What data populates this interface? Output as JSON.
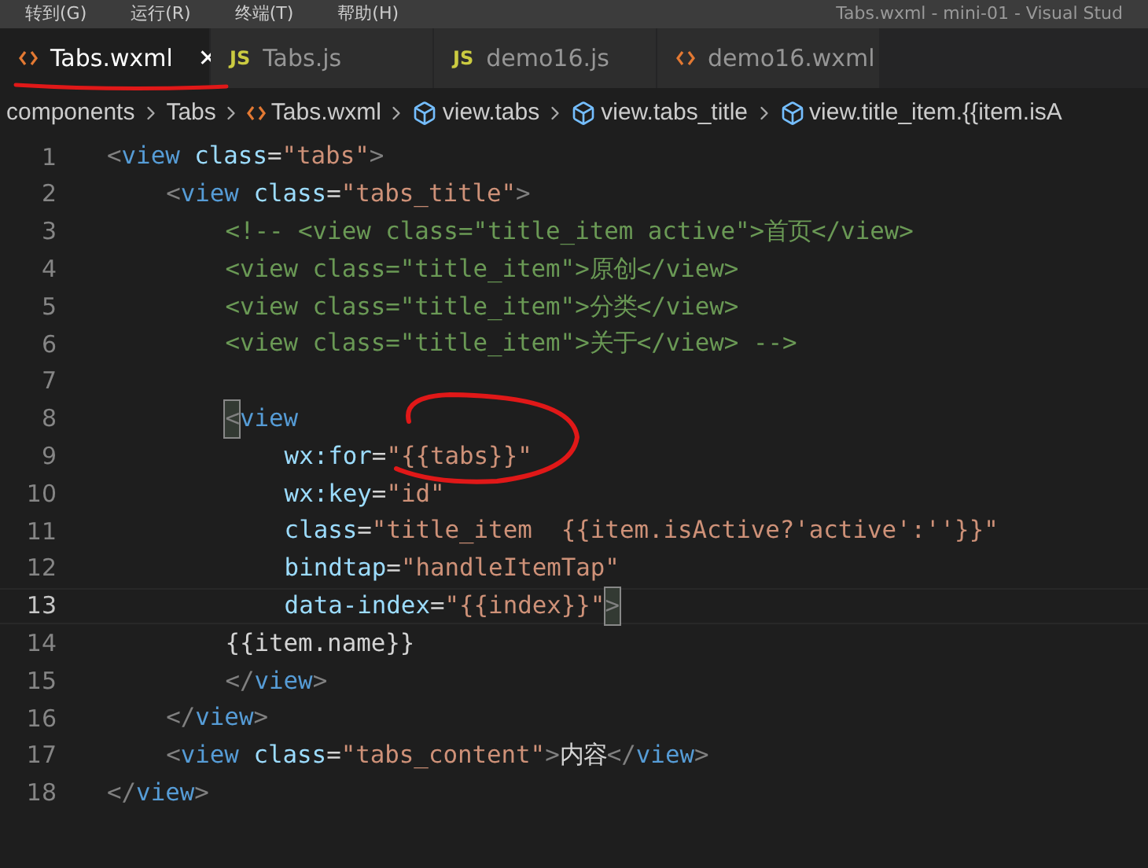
{
  "menu_bar": {
    "items": [
      "转到(G)",
      "运行(R)",
      "终端(T)",
      "帮助(H)"
    ],
    "title": "Tabs.wxml - mini-01 - Visual Stud"
  },
  "tabs": [
    {
      "label": "Tabs.wxml",
      "kind": "wxml",
      "selected": true,
      "close": "✕"
    },
    {
      "label": "Tabs.js",
      "kind": "js",
      "badge": "JS",
      "selected": false
    },
    {
      "label": "demo16.js",
      "kind": "js",
      "badge": "JS",
      "selected": false
    },
    {
      "label": "demo16.wxml",
      "kind": "wxml",
      "selected": false
    }
  ],
  "breadcrumb": [
    {
      "label": "components",
      "kind": "folder"
    },
    {
      "label": "Tabs",
      "kind": "folder"
    },
    {
      "label": "Tabs.wxml",
      "kind": "file"
    },
    {
      "label": "view.tabs",
      "kind": "symbol"
    },
    {
      "label": "view.tabs_title",
      "kind": "symbol"
    },
    {
      "label": "view.title_item.{{item.isA",
      "kind": "symbol"
    }
  ],
  "editor": {
    "lines": [
      {
        "number": "1",
        "current": false,
        "tokens": [
          {
            "kind": "bracket",
            "text": "<"
          },
          {
            "kind": "tag",
            "text": "view"
          },
          {
            "kind": "attr",
            "text": " class"
          },
          {
            "kind": "plain",
            "text": "="
          },
          {
            "kind": "string",
            "text": "\"tabs\""
          },
          {
            "kind": "bracket",
            "text": ">"
          }
        ],
        "children": [
          {
            "number": "2",
            "current": false,
            "tokens": [
              {
                "kind": "bracket",
                "text": "<"
              },
              {
                "kind": "tag",
                "text": "view"
              },
              {
                "kind": "attr",
                "text": " class"
              },
              {
                "kind": "plain",
                "text": "="
              },
              {
                "kind": "string",
                "text": "\"tabs_title\""
              },
              {
                "kind": "bracket",
                "text": ">"
              }
            ],
            "children": [
              {
                "number": "3",
                "current": false,
                "tokens": [
                  {
                    "kind": "comment",
                    "text": "<!-- <view class=\"title_item active\">首页</view>"
                  }
                ]
              },
              {
                "number": "4",
                "current": false,
                "tokens": [
                  {
                    "kind": "comment",
                    "text": "<view class=\"title_item\">原创</view>"
                  }
                ]
              },
              {
                "number": "5",
                "current": false,
                "tokens": [
                  {
                    "kind": "comment",
                    "text": "<view class=\"title_item\">分类</view>"
                  }
                ]
              },
              {
                "number": "6",
                "current": false,
                "tokens": [
                  {
                    "kind": "comment",
                    "text": "<view class=\"title_item\">关于</view> -->"
                  }
                ]
              },
              {
                "number": "7",
                "current": false
              },
              {
                "number": "8",
                "current": false,
                "tokens": [
                  {
                    "kind": "match",
                    "text": "<"
                  },
                  {
                    "kind": "tag",
                    "text": "view"
                  }
                ],
                "children": [
                  {
                    "number": "9",
                    "current": false,
                    "tokens": [
                      {
                        "kind": "attr",
                        "text": "wx:for"
                      },
                      {
                        "kind": "plain",
                        "text": "="
                      },
                      {
                        "kind": "string",
                        "text": "\"{{tabs}}\""
                      }
                    ]
                  },
                  {
                    "number": "10",
                    "current": false,
                    "tokens": [
                      {
                        "kind": "attr",
                        "text": "wx:key"
                      },
                      {
                        "kind": "plain",
                        "text": "="
                      },
                      {
                        "kind": "string",
                        "text": "\"id\""
                      }
                    ]
                  },
                  {
                    "number": "11",
                    "current": false,
                    "tokens": [
                      {
                        "kind": "attr",
                        "text": "class"
                      },
                      {
                        "kind": "plain",
                        "text": "="
                      },
                      {
                        "kind": "string",
                        "text": "\"title_item  {{item.isActive?'active':''}}\""
                      }
                    ]
                  },
                  {
                    "number": "12",
                    "current": false,
                    "tokens": [
                      {
                        "kind": "attr",
                        "text": "bindtap"
                      },
                      {
                        "kind": "plain",
                        "text": "="
                      },
                      {
                        "kind": "string",
                        "text": "\"handleItemTap\""
                      }
                    ]
                  },
                  {
                    "number": "13",
                    "current": true,
                    "tokens": [
                      {
                        "kind": "attr",
                        "text": "data-index"
                      },
                      {
                        "kind": "plain",
                        "text": "="
                      },
                      {
                        "kind": "string",
                        "text": "\"{{index}}\""
                      },
                      {
                        "kind": "match",
                        "text": ">"
                      }
                    ]
                  }
                ]
              },
              {
                "number": "14",
                "current": false,
                "tokens": [
                  {
                    "kind": "plain",
                    "text": "{{item.name}}"
                  }
                ]
              },
              {
                "number": "15",
                "current": false,
                "tokens": [
                  {
                    "kind": "bracket",
                    "text": "</"
                  },
                  {
                    "kind": "tag",
                    "text": "view"
                  },
                  {
                    "kind": "bracket",
                    "text": ">"
                  }
                ]
              }
            ]
          },
          {
            "number": "16",
            "current": false,
            "tokens": [
              {
                "kind": "bracket",
                "text": "</"
              },
              {
                "kind": "tag",
                "text": "view"
              },
              {
                "kind": "bracket",
                "text": ">"
              }
            ]
          },
          {
            "number": "17",
            "current": false,
            "tokens": [
              {
                "kind": "bracket",
                "text": "<"
              },
              {
                "kind": "tag",
                "text": "view"
              },
              {
                "kind": "attr",
                "text": " class"
              },
              {
                "kind": "plain",
                "text": "="
              },
              {
                "kind": "string",
                "text": "\"tabs_content\""
              },
              {
                "kind": "bracket",
                "text": ">"
              },
              {
                "kind": "plain",
                "text": "内容"
              },
              {
                "kind": "bracket",
                "text": "</"
              },
              {
                "kind": "tag",
                "text": "view"
              },
              {
                "kind": "bracket",
                "text": ">"
              }
            ]
          }
        ]
      },
      {
        "number": "18",
        "current": false,
        "tokens": [
          {
            "kind": "bracket",
            "text": "</"
          },
          {
            "kind": "tag",
            "text": "view"
          },
          {
            "kind": "bracket",
            "text": ">"
          }
        ]
      }
    ]
  }
}
